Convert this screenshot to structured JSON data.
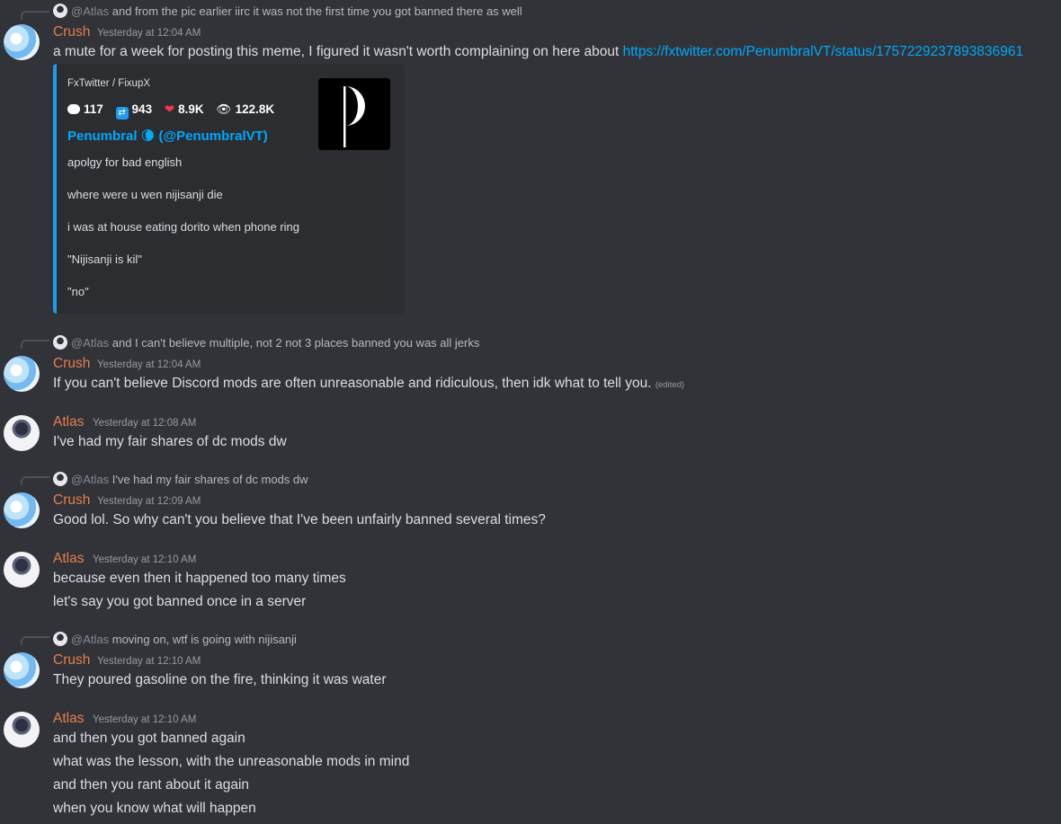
{
  "messages": [
    {
      "reply": {
        "mention": "@Atlas",
        "text": "and from the pic earlier iirc it was not the first time you got banned there as well"
      },
      "author": "Crush",
      "timestamp": "Yesterday at 12:04 AM",
      "text": "a mute for a week for posting this meme, I figured it wasn't worth complaining on here about ",
      "link": "https://fxtwitter.com/PenumbralVT/status/1757229237893836961",
      "embed": {
        "provider": "FxTwitter / FixupX",
        "stats": {
          "replies": "117",
          "retweets": "943",
          "likes": "8.9K",
          "views": "122.8K"
        },
        "author": "Penumbral 🌘 (@PenumbralVT)",
        "lines": [
          "apolgy for bad english",
          "where were u wen nijisanji die",
          "i was at house eating dorito when phone ring",
          "\"Nijisanji is kil\"",
          "\"no\""
        ],
        "accent": "#1d9bf0"
      }
    },
    {
      "reply": {
        "mention": "@Atlas",
        "text": "and I can't believe multiple, not 2 not 3 places banned you was all jerks"
      },
      "author": "Crush",
      "timestamp": "Yesterday at 12:04 AM",
      "text": "If you can't believe Discord mods are often unreasonable and ridiculous, then idk what to tell you.",
      "edited": "(edited)"
    },
    {
      "author": "Atlas",
      "timestamp": "Yesterday at 12:08 AM",
      "lines": [
        "I've had my fair shares of dc mods dw"
      ]
    },
    {
      "reply": {
        "mention": "@Atlas",
        "text": "I've had my fair shares of dc mods dw"
      },
      "author": "Crush",
      "timestamp": "Yesterday at 12:09 AM",
      "lines": [
        "Good lol. So why can't you believe that I've been unfairly banned several times?"
      ]
    },
    {
      "author": "Atlas",
      "timestamp": "Yesterday at 12:10 AM",
      "lines": [
        "because even then it happened too many times",
        "let's say you got banned once in a server"
      ]
    },
    {
      "reply": {
        "mention": "@Atlas",
        "text": "moving on, wtf is going with nijisanji"
      },
      "author": "Crush",
      "timestamp": "Yesterday at 12:10 AM",
      "lines": [
        "They poured gasoline on the fire, thinking it was water"
      ]
    },
    {
      "author": "Atlas",
      "timestamp": "Yesterday at 12:10 AM",
      "lines": [
        "and then you got banned again",
        "what was the lesson, with the unreasonable mods in mind",
        "and then you rant about it again",
        "when you know what will happen"
      ]
    }
  ],
  "colors": {
    "background": "#313338",
    "author": "#e67e4f",
    "link": "#00a8fc",
    "embed_bg": "#2b2d31"
  }
}
